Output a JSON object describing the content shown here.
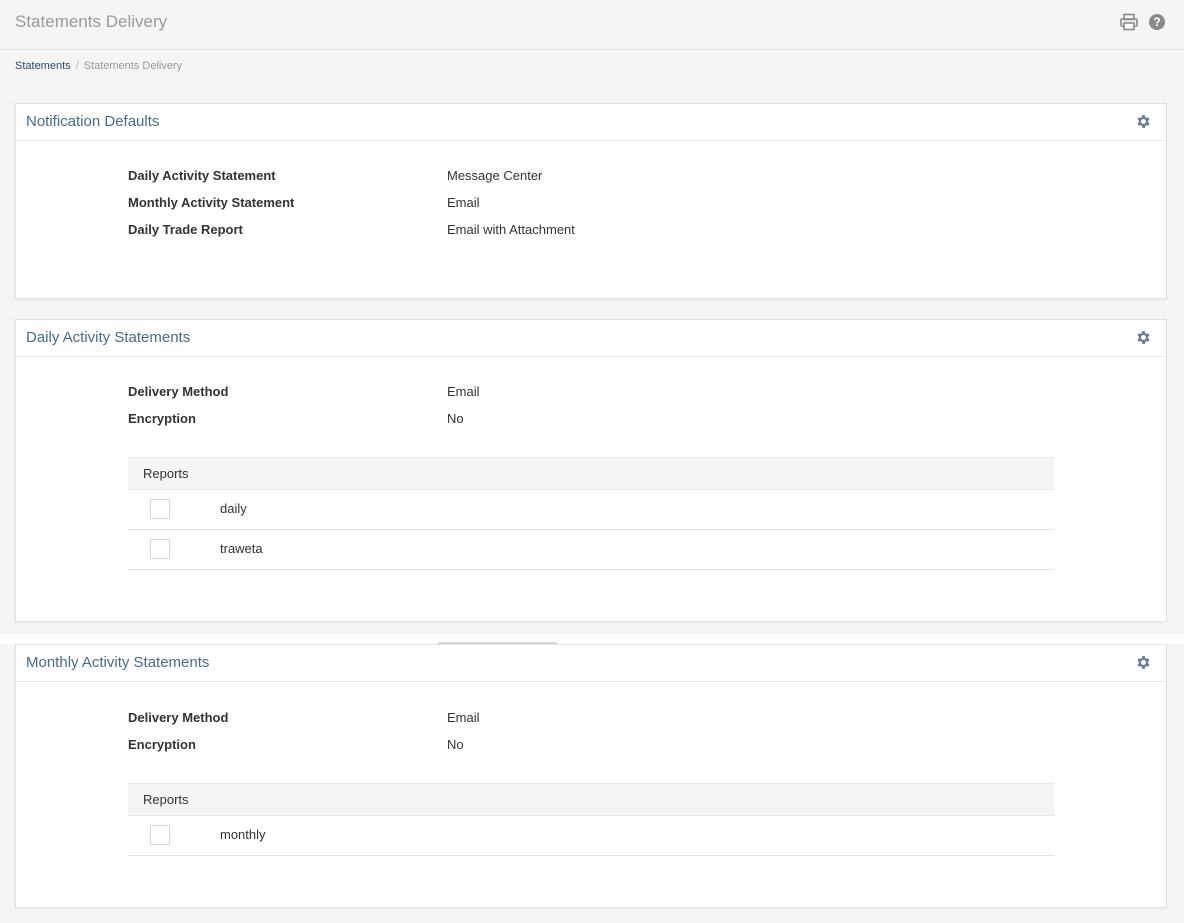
{
  "header": {
    "title": "Statements Delivery",
    "icons": [
      "print-icon",
      "help-icon"
    ]
  },
  "breadcrumb": {
    "parent": "Statements",
    "separator": "/",
    "current": "Statements Delivery"
  },
  "notification_defaults": {
    "title": "Notification Defaults",
    "rows": [
      {
        "label": "Daily Activity Statement",
        "value": "Message Center"
      },
      {
        "label": "Monthly Activity Statement",
        "value": "Email"
      },
      {
        "label": "Daily Trade Report",
        "value": "Email with Attachment"
      }
    ]
  },
  "daily": {
    "title": "Daily Activity Statements",
    "delivery_label": "Delivery Method",
    "delivery_value": "Email",
    "encryption_label": "Encryption",
    "encryption_value": "No",
    "reports_header": "Reports",
    "reports": [
      "daily",
      "traweta"
    ]
  },
  "monthly": {
    "title": "Monthly Activity Statements",
    "delivery_label": "Delivery Method",
    "delivery_value": "Email",
    "encryption_label": "Encryption",
    "encryption_value": "No",
    "reports_header": "Reports",
    "reports": [
      "monthly"
    ]
  },
  "colors": {
    "accent": "#4a6a8a",
    "link": "#2b4a6b",
    "gear": "#6b7f99"
  }
}
